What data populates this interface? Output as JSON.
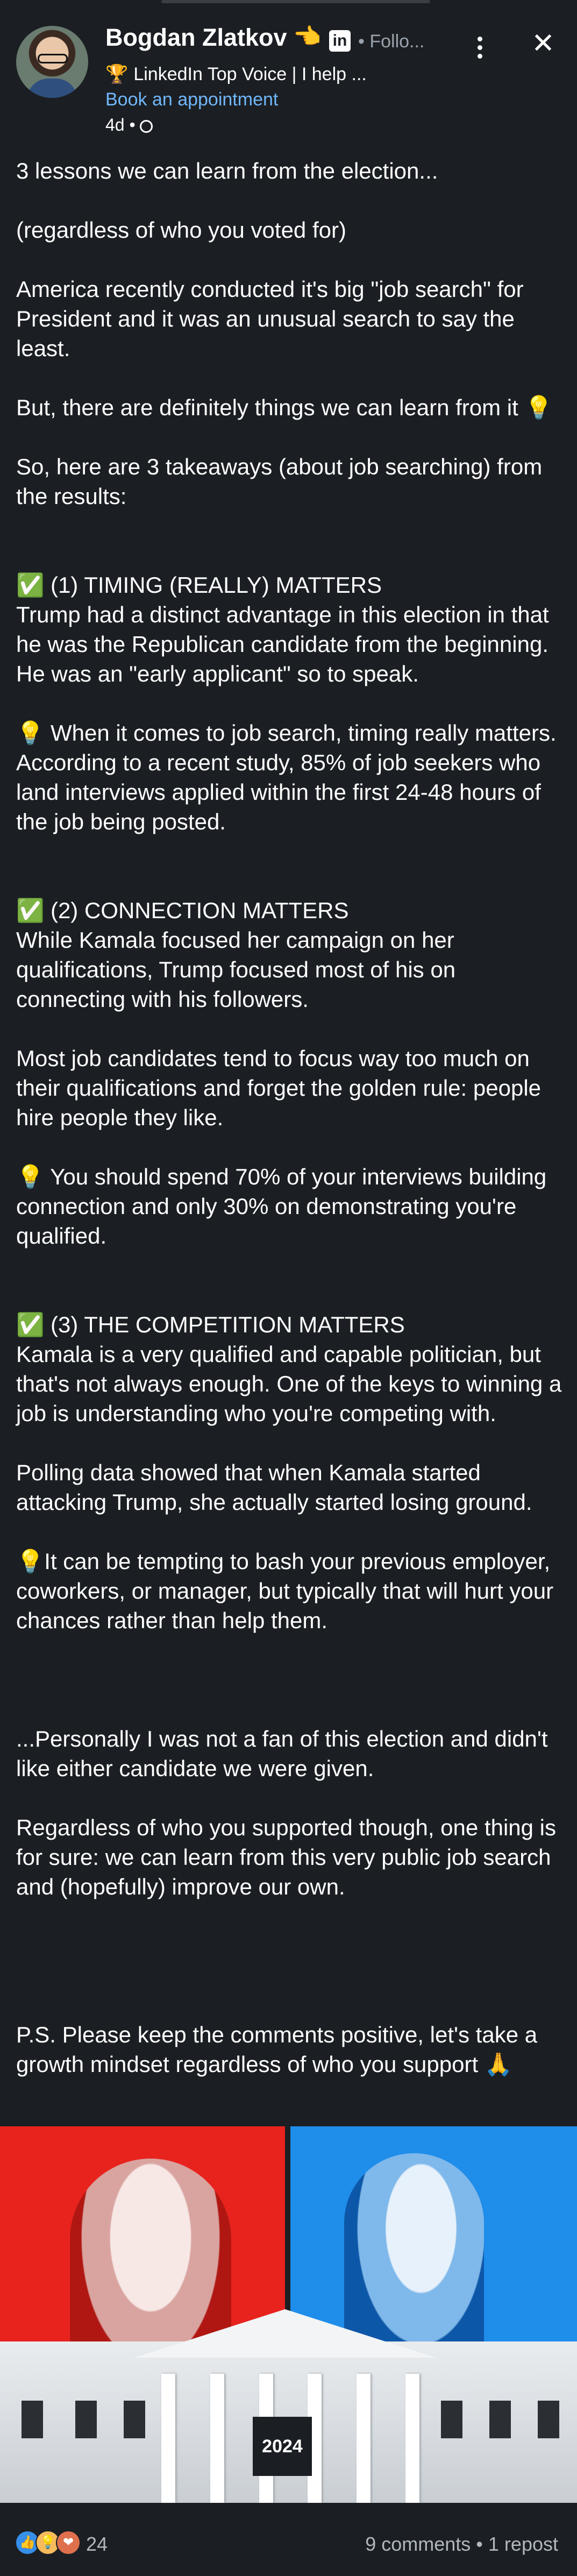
{
  "author": {
    "name": "Bogdan Zlatkov",
    "name_emoji": "👈",
    "linkedin_badge": "in",
    "follow_label": "• Follo...",
    "headline_icon": "🏆",
    "headline": "LinkedIn Top Voice | I help ...",
    "cta_link": "Book an appointment",
    "time_ago": "4d •",
    "visibility_icon": "globe-icon"
  },
  "header_actions": {
    "more_icon": "kebab-menu-icon",
    "close_glyph": "✕"
  },
  "post": {
    "paragraphs": [
      "3 lessons we can learn from the election...",
      "(regardless of who you voted for)",
      "America recently conducted it's big \"job search\" for President and it was an unusual search to say the least.",
      "But, there are definitely things we can learn from it 💡",
      "So, here are 3 takeaways (about job searching) from the results:",
      "✅ (1) TIMING (REALLY) MATTERS\nTrump had a distinct advantage in this election in that he was the Republican candidate from the beginning. He was an \"early applicant\" so to speak.",
      "💡 When it comes to job search, timing really matters. According to a recent study, 85% of job seekers who land interviews applied within the first 24-48 hours of the job being posted.",
      "✅ (2) CONNECTION MATTERS\nWhile Kamala focused her campaign on her qualifications, Trump focused most of his on connecting with his followers.",
      "Most job candidates tend to focus way too much on their qualifications and forget the golden rule: people hire people they like.",
      "💡 You should spend 70% of your interviews building connection and only 30% on demonstrating you're qualified.",
      "✅ (3) THE COMPETITION MATTERS\nKamala is a very qualified and capable politician, but that's not always enough. One of the keys to winning a job is understanding who you're competing with.",
      "Polling data showed that when Kamala started attacking Trump, she actually started losing ground.",
      "💡It can be tempting to bash your previous employer, coworkers, or manager, but typically that will hurt your chances rather than help them.",
      "...Personally I was not a fan of this election and didn't like either candidate we were given.",
      "Regardless of who you supported though, one thing is for sure: we can learn from this very public job search and (hopefully) improve our own.",
      "P.S. Please keep the comments positive, let's take a growth mindset regardless of who you support 🙏"
    ]
  },
  "image": {
    "banner_text": "2024",
    "left_color": "#e8231e",
    "right_color": "#1f8dea"
  },
  "social": {
    "reaction_icons": [
      "👍",
      "💡",
      "❤"
    ],
    "reaction_count": "24",
    "comments_reposts": "9 comments • 1 repost"
  },
  "colors": {
    "background": "#1b1f23",
    "link": "#71b7fb",
    "muted": "#b0b7bf"
  }
}
